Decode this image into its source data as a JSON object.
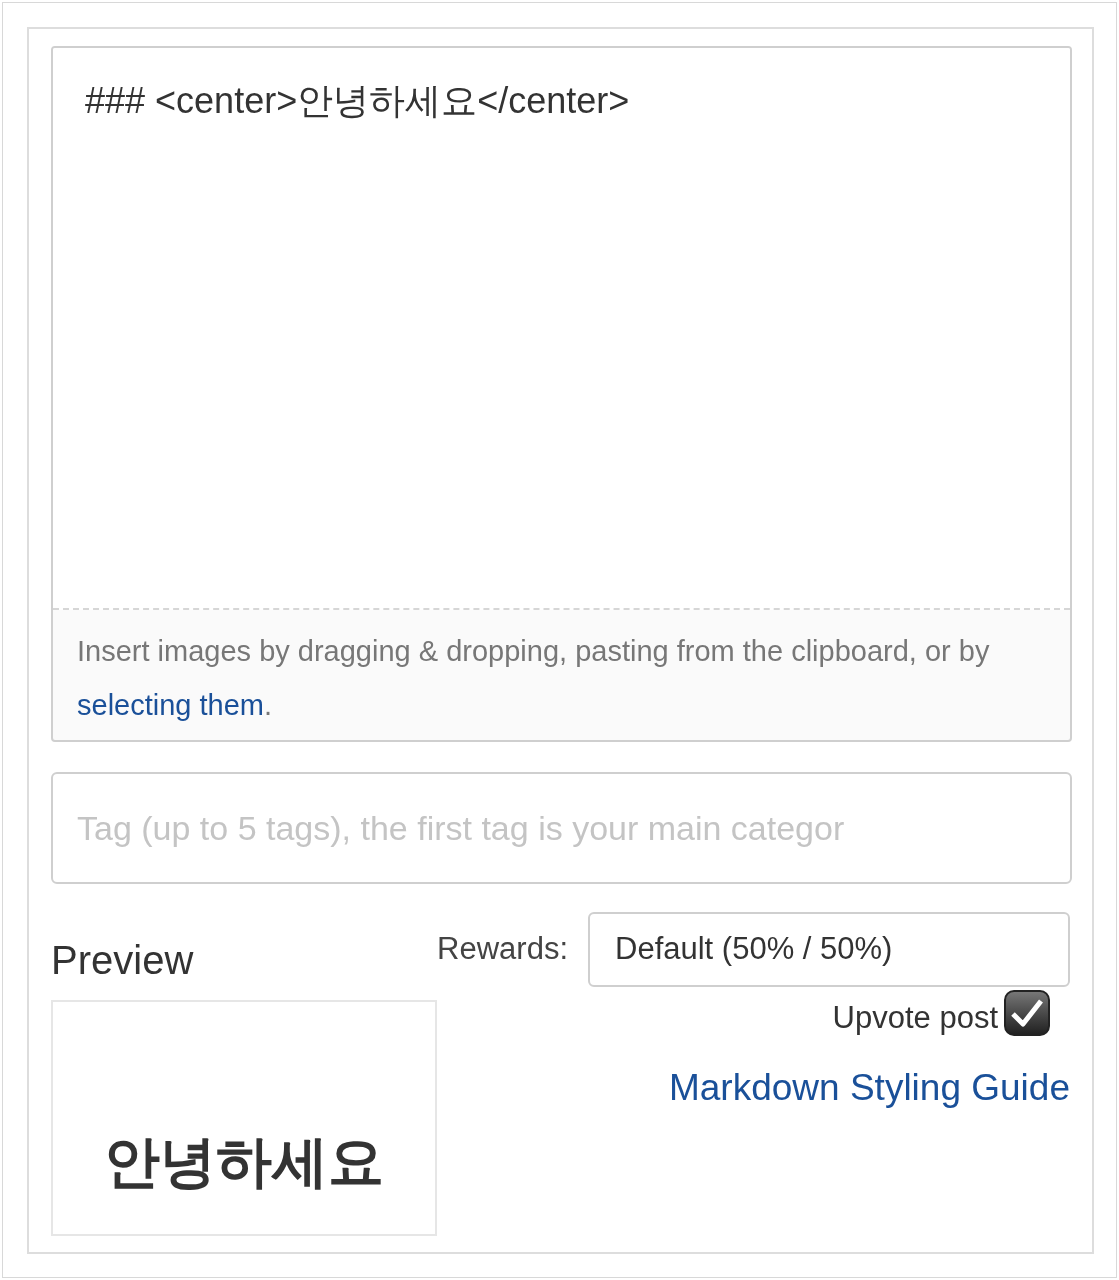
{
  "editor": {
    "value": "### <center>안녕하세요</center>",
    "hint": "Insert images by dragging & dropping, pasting from the clipboard, or by ",
    "hint_link": "selecting them",
    "hint_end": "."
  },
  "tags": {
    "placeholder": "Tag (up to 5 tags), the first tag is your main categor"
  },
  "preview": {
    "title": "Preview",
    "heading": "안녕하세요"
  },
  "rewards": {
    "label": "Rewards:",
    "value": "Default (50% / 50%)"
  },
  "upvote": {
    "label": "Upvote post",
    "checked": true
  },
  "guide_link": "Markdown Styling Guide"
}
